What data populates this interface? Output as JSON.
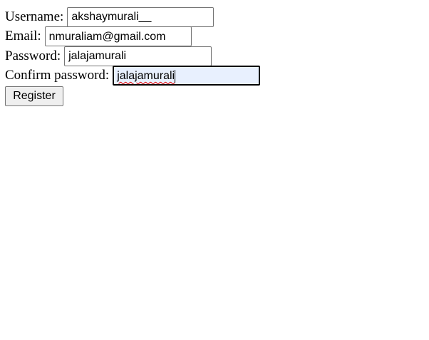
{
  "form": {
    "username": {
      "label": "Username:",
      "value": "akshaymurali__"
    },
    "email": {
      "label": "Email:",
      "value": "nmuraliam@gmail.com"
    },
    "password": {
      "label": "Password:",
      "value": "jalajamurali"
    },
    "confirm_password": {
      "label": "Confirm password:",
      "value": "jalajamurali"
    },
    "submit_label": "Register"
  },
  "colors": {
    "focus_background": "#e8f0fe",
    "spellcheck_underline": "#e00000",
    "button_background": "#efefef"
  }
}
